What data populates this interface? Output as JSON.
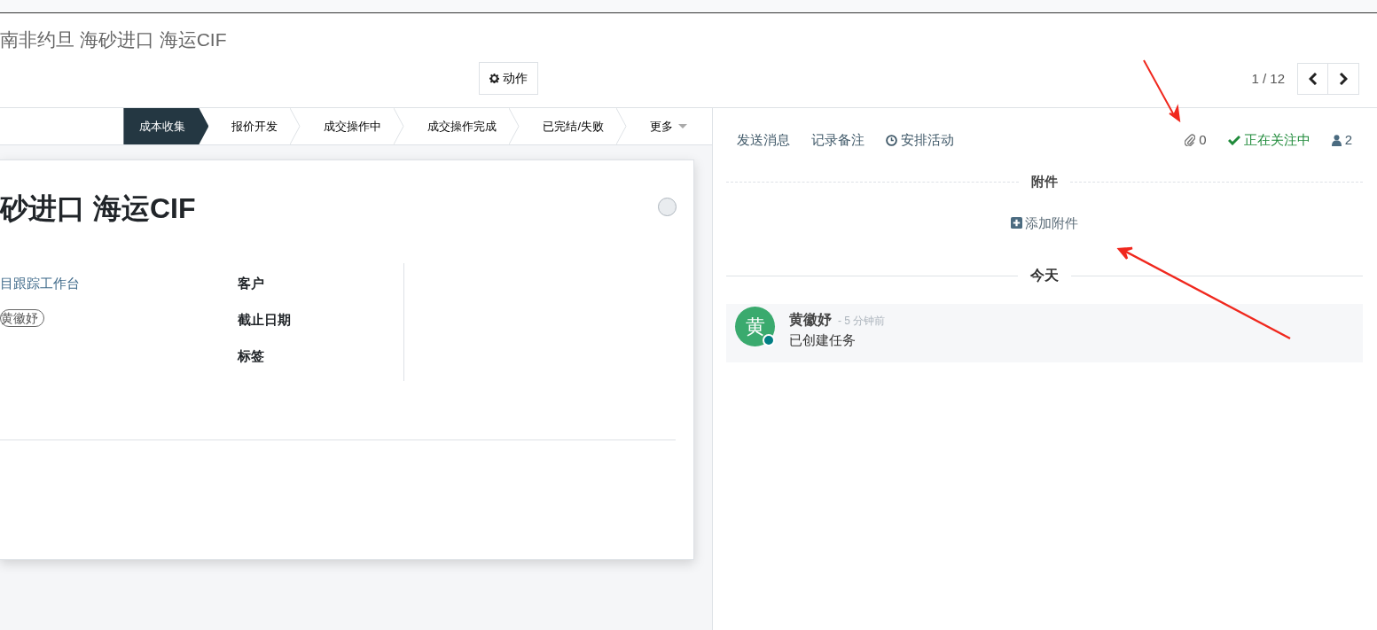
{
  "title": "南非约旦 海砂进口 海运CIF",
  "action_button": {
    "label": "动作"
  },
  "pager": {
    "value": "1 / 12"
  },
  "statusbar": {
    "stages": [
      {
        "label": "成本收集",
        "selected": true
      },
      {
        "label": "报价开发",
        "selected": false
      },
      {
        "label": "成交操作中",
        "selected": false
      },
      {
        "label": "成交操作完成",
        "selected": false
      },
      {
        "label": "已完结/失败",
        "selected": false
      }
    ],
    "more": "更多"
  },
  "sheet": {
    "title": "砂进口 海运CIF",
    "values": [
      {
        "kind": "link",
        "value": "目跟踪工作台"
      },
      {
        "kind": "tag",
        "value": "黄徽妤"
      }
    ],
    "labels": [
      "客户",
      "截止日期",
      "标签"
    ]
  },
  "chatter": {
    "actions": [
      {
        "kind": "plain",
        "label": "发送消息"
      },
      {
        "kind": "plain",
        "label": "记录备注"
      },
      {
        "kind": "activity",
        "label": "安排活动"
      }
    ],
    "attachment_count": "0",
    "follow_label": "正在关注中",
    "followers_count": "2",
    "attachments": {
      "title": "附件",
      "add": "添加附件"
    },
    "date_separator": "今天",
    "messages": [
      {
        "avatar": "黄",
        "author": "黄徽妤",
        "time": "- 5 分钟前",
        "body": "已创建任务"
      }
    ]
  }
}
